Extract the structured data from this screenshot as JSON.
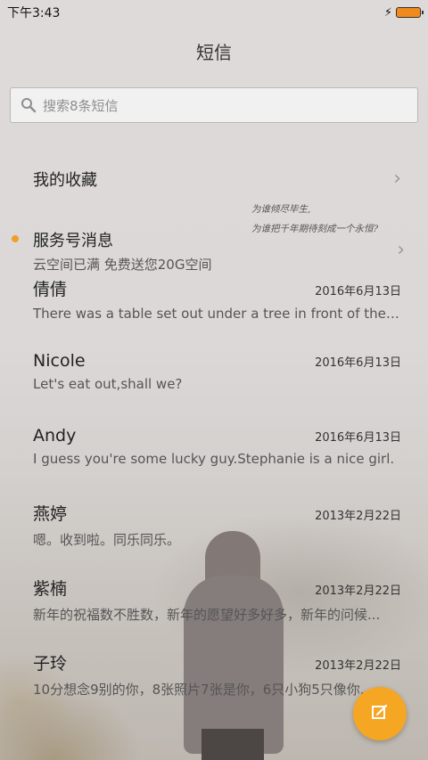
{
  "status": {
    "time": "下午3:43"
  },
  "header": {
    "title": "短信"
  },
  "search": {
    "placeholder": "搜索8条短信"
  },
  "favorites": {
    "label": "我的收藏"
  },
  "service": {
    "title": "服务号消息",
    "subtitle": "云空间已满 免费送您20G空间"
  },
  "quote": {
    "line1": "为谁倾尽毕生,",
    "line2": "为谁把千年期待刻成一个永恒?"
  },
  "messages": [
    {
      "name": "倩倩",
      "date": "2016年6月13日",
      "preview": "There was a table set out under a tree in front of the ho..."
    },
    {
      "name": "Nicole",
      "date": "2016年6月13日",
      "preview": "Let's eat out,shall we?"
    },
    {
      "name": "Andy",
      "date": "2016年6月13日",
      "preview": "I guess you're some lucky guy.Stephanie is a nice girl."
    },
    {
      "name": "燕婷",
      "date": "2013年2月22日",
      "preview": "嗯。收到啦。同乐同乐。"
    },
    {
      "name": "紫楠",
      "date": "2013年2月22日",
      "preview": "新年的祝福数不胜数，新年的愿望好多好多，新年的问候..."
    },
    {
      "name": "子玲",
      "date": "2013年2月22日",
      "preview": "10分想念9别的你，8张照片7张是你，6只小狗5只像你..."
    }
  ],
  "fab": {
    "icon": "compose-icon",
    "color": "#f5a623"
  },
  "colors": {
    "accent": "#f5a623",
    "unread_dot": "#f0a024"
  }
}
